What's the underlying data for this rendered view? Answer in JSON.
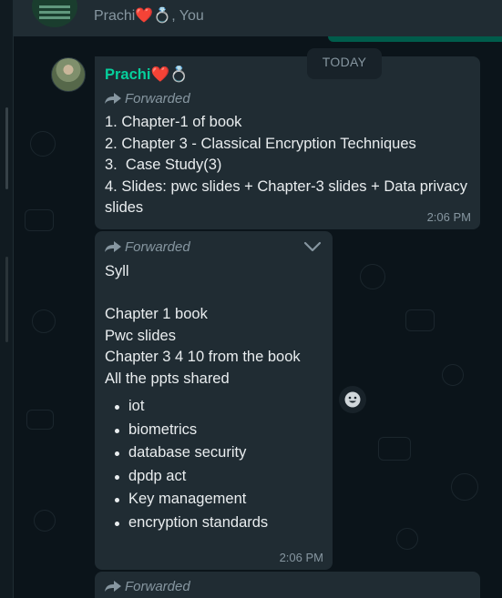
{
  "header": {
    "members": "Prachi❤️💍, You"
  },
  "date_chip": "TODAY",
  "messages": [
    {
      "sender": "Prachi❤️💍",
      "forwarded": "Forwarded",
      "lines": [
        "1. Chapter-1 of book",
        "2. Chapter 3 - Classical Encryption Techniques",
        "3.  Case Study(3)",
        "4. Slides: pwc slides + Chapter-3 slides + Data privacy slides"
      ],
      "time": "2:06 PM"
    },
    {
      "forwarded": "Forwarded",
      "lines": [
        "Syll",
        "",
        "Chapter 1 book",
        "Pwc slides",
        "Chapter 3 4 10 from the book",
        "All the ppts shared"
      ],
      "bullets": [
        "iot",
        "biometrics",
        "database security",
        "dpdp act",
        "Key management",
        "encryption standards"
      ],
      "time": "2:06 PM"
    },
    {
      "forwarded": "Forwarded"
    }
  ],
  "icons": {
    "forward": "forward-arrow-icon",
    "menu": "chevron-down-icon",
    "react": "emoji-smile-icon"
  },
  "colors": {
    "bubble_incoming": "#202c33",
    "bubble_outgoing": "#005c4b",
    "sender_name": "#06cf9c",
    "wallpaper": "#0b141a",
    "meta_text": "#8696a0"
  }
}
